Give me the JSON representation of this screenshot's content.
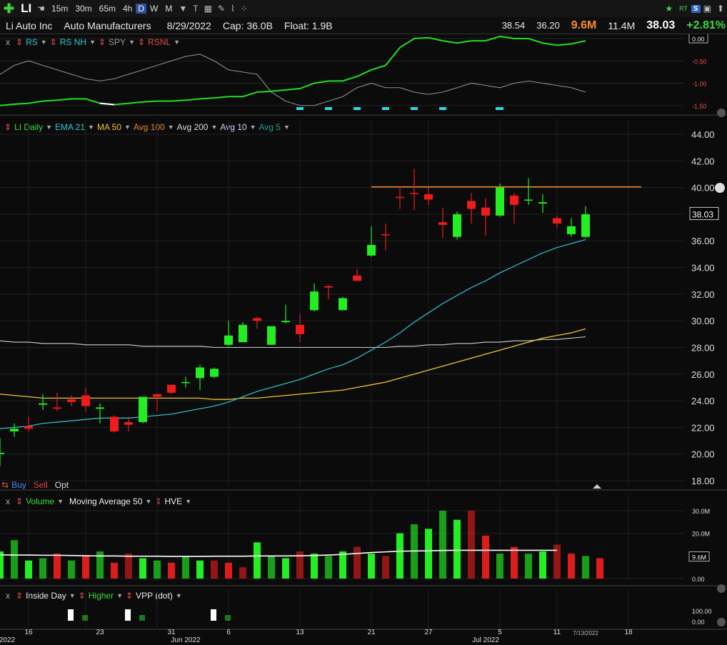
{
  "toolbar": {
    "symbol": "LI",
    "timeframes": [
      "15m",
      "30m",
      "65m",
      "4h",
      "D",
      "W",
      "M"
    ],
    "selected_timeframe": "D",
    "right_rt": "RT",
    "right_s": "S"
  },
  "info": {
    "company": "Li Auto Inc",
    "industry": "Auto Manufacturers",
    "date": "8/29/2022",
    "cap": "Cap: 36.0B",
    "float": "Float: 1.9B",
    "high": "38.54",
    "low": "36.20",
    "volume": "9.6M",
    "avg_volume": "11.4M",
    "last": "38.03",
    "change": "+2.81%"
  },
  "rs_panel": {
    "x": "x",
    "items": [
      "RS",
      "RS NH",
      "SPY",
      "RSNL"
    ],
    "axis": [
      "0.00",
      "-0.50",
      "-1.00",
      "-1.50"
    ]
  },
  "price_panel": {
    "legend": [
      "LI Daily",
      "EMA 21",
      "MA 50",
      "Avg 100",
      "Avg 200",
      "Avg 10",
      "Avg 5"
    ],
    "axis": [
      "44.00",
      "42.00",
      "40.00",
      "38.00",
      "36.00",
      "34.00",
      "32.00",
      "30.00",
      "28.00",
      "26.00",
      "24.00",
      "22.00",
      "20.00",
      "18.00"
    ],
    "last_label": "38.03",
    "buy": "Buy",
    "sell": "Sell",
    "opt": "Opt"
  },
  "volume_panel": {
    "x": "x",
    "items": [
      "Volume",
      "Moving Average 50",
      "HVE"
    ],
    "axis": [
      "30.0M",
      "20.0M",
      "9.6M",
      "0.00"
    ]
  },
  "inside_panel": {
    "x": "x",
    "items": [
      "Inside Day",
      "Higher",
      "VPP (dot)"
    ],
    "axis": [
      "100.00",
      "0.00"
    ]
  },
  "xaxis": {
    "ticks": [
      "16",
      "23",
      "31",
      "6",
      "13",
      "21",
      "27",
      "5",
      "11",
      "18"
    ],
    "months": [
      "2022",
      "Jun 2022",
      "Jul 2022"
    ],
    "current": "7/13/2022"
  },
  "chart_data": {
    "type": "candlestick",
    "title": "LI Daily",
    "ylim": [
      18,
      44
    ],
    "resistance": 40.05,
    "candles": [
      {
        "o": 20.1,
        "h": 21.2,
        "l": 19.1,
        "c": 20.0,
        "up": true
      },
      {
        "o": 21.7,
        "h": 22.3,
        "l": 21.3,
        "c": 21.9,
        "up": true
      },
      {
        "o": 22.1,
        "h": 22.8,
        "l": 21.7,
        "c": 21.9,
        "up": false
      },
      {
        "o": 23.7,
        "h": 24.5,
        "l": 23.3,
        "c": 23.8,
        "up": true
      },
      {
        "o": 23.5,
        "h": 24.6,
        "l": 23.2,
        "c": 23.4,
        "up": false
      },
      {
        "o": 24.1,
        "h": 24.4,
        "l": 23.6,
        "c": 23.9,
        "up": false
      },
      {
        "o": 24.4,
        "h": 25.0,
        "l": 23.2,
        "c": 23.6,
        "up": false
      },
      {
        "o": 23.4,
        "h": 23.8,
        "l": 22.3,
        "c": 23.5,
        "up": true
      },
      {
        "o": 22.8,
        "h": 22.9,
        "l": 21.6,
        "c": 21.7,
        "up": false
      },
      {
        "o": 22.4,
        "h": 22.8,
        "l": 21.7,
        "c": 22.2,
        "up": false
      },
      {
        "o": 22.4,
        "h": 24.3,
        "l": 22.3,
        "c": 24.3,
        "up": true
      },
      {
        "o": 24.5,
        "h": 24.5,
        "l": 23.2,
        "c": 24.3,
        "up": false
      },
      {
        "o": 25.2,
        "h": 25.2,
        "l": 24.5,
        "c": 24.6,
        "up": false
      },
      {
        "o": 25.4,
        "h": 25.8,
        "l": 25.0,
        "c": 25.4,
        "up": true
      },
      {
        "o": 25.7,
        "h": 26.7,
        "l": 24.8,
        "c": 26.5,
        "up": true
      },
      {
        "o": 25.8,
        "h": 26.5,
        "l": 25.7,
        "c": 26.4,
        "up": true
      },
      {
        "o": 28.2,
        "h": 30.0,
        "l": 28.1,
        "c": 28.9,
        "up": true
      },
      {
        "o": 28.4,
        "h": 29.9,
        "l": 28.4,
        "c": 29.7,
        "up": true
      },
      {
        "o": 30.2,
        "h": 30.3,
        "l": 29.4,
        "c": 30.0,
        "up": false
      },
      {
        "o": 28.2,
        "h": 29.6,
        "l": 28.2,
        "c": 29.6,
        "up": true
      },
      {
        "o": 30.0,
        "h": 31.2,
        "l": 29.8,
        "c": 29.9,
        "up": true
      },
      {
        "o": 29.7,
        "h": 30.5,
        "l": 28.4,
        "c": 29.0,
        "up": false
      },
      {
        "o": 30.8,
        "h": 32.8,
        "l": 30.7,
        "c": 32.2,
        "up": true
      },
      {
        "o": 32.6,
        "h": 32.7,
        "l": 31.6,
        "c": 32.5,
        "up": false
      },
      {
        "o": 30.8,
        "h": 31.8,
        "l": 30.8,
        "c": 31.7,
        "up": true
      },
      {
        "o": 33.4,
        "h": 33.9,
        "l": 33.1,
        "c": 33.0,
        "up": false
      },
      {
        "o": 34.9,
        "h": 37.1,
        "l": 34.8,
        "c": 35.7,
        "up": true
      },
      {
        "o": 36.5,
        "h": 37.3,
        "l": 35.3,
        "c": 36.5,
        "up": false
      },
      {
        "o": 39.3,
        "h": 40.1,
        "l": 38.4,
        "c": 39.3,
        "up": false
      },
      {
        "o": 39.6,
        "h": 41.4,
        "l": 38.3,
        "c": 39.6,
        "up": false
      },
      {
        "o": 39.5,
        "h": 40.0,
        "l": 38.7,
        "c": 39.1,
        "up": false
      },
      {
        "o": 37.4,
        "h": 38.5,
        "l": 36.2,
        "c": 37.2,
        "up": false
      },
      {
        "o": 36.3,
        "h": 38.2,
        "l": 36.1,
        "c": 38.0,
        "up": true
      },
      {
        "o": 39.0,
        "h": 39.6,
        "l": 37.3,
        "c": 38.4,
        "up": false
      },
      {
        "o": 38.5,
        "h": 39.2,
        "l": 36.4,
        "c": 37.9,
        "up": false
      },
      {
        "o": 37.9,
        "h": 40.3,
        "l": 37.8,
        "c": 40.0,
        "up": true
      },
      {
        "o": 39.4,
        "h": 39.6,
        "l": 37.3,
        "c": 38.7,
        "up": false
      },
      {
        "o": 39.1,
        "h": 40.7,
        "l": 38.7,
        "c": 39.1,
        "up": true
      },
      {
        "o": 38.9,
        "h": 39.5,
        "l": 38.1,
        "c": 38.8,
        "up": true
      },
      {
        "o": 37.7,
        "h": 37.9,
        "l": 37.0,
        "c": 37.3,
        "up": false
      },
      {
        "o": 36.5,
        "h": 37.7,
        "l": 36.3,
        "c": 37.1,
        "up": true
      },
      {
        "o": 36.3,
        "h": 38.6,
        "l": 36.2,
        "c": 38.0,
        "up": true
      }
    ],
    "ema21": [
      21.9,
      22.0,
      22.1,
      22.3,
      22.4,
      22.5,
      22.6,
      22.7,
      22.7,
      22.7,
      22.8,
      22.9,
      23.0,
      23.2,
      23.4,
      23.6,
      23.9,
      24.3,
      24.7,
      25.0,
      25.3,
      25.6,
      26.0,
      26.4,
      26.7,
      27.2,
      27.8,
      28.4,
      29.1,
      29.9,
      30.6,
      31.3,
      31.9,
      32.5,
      33.0,
      33.6,
      34.1,
      34.6,
      35.1,
      35.5,
      35.8,
      36.1
    ],
    "ma50": [
      24.5,
      24.4,
      24.3,
      24.2,
      24.2,
      24.2,
      24.2,
      24.2,
      24.2,
      24.2,
      24.2,
      24.2,
      24.2,
      24.2,
      24.2,
      24.1,
      24.1,
      24.2,
      24.2,
      24.3,
      24.4,
      24.5,
      24.6,
      24.7,
      24.8,
      25.0,
      25.2,
      25.4,
      25.7,
      26.0,
      26.3,
      26.6,
      26.9,
      27.2,
      27.5,
      27.8,
      28.1,
      28.4,
      28.7,
      28.9,
      29.1,
      29.4
    ],
    "avg200": [
      28.5,
      28.4,
      28.4,
      28.3,
      28.3,
      28.3,
      28.2,
      28.2,
      28.2,
      28.2,
      28.1,
      28.1,
      28.1,
      28.1,
      28.1,
      28.0,
      28.0,
      28.0,
      28.0,
      28.0,
      28.0,
      28.0,
      28.0,
      28.0,
      28.0,
      28.0,
      28.0,
      28.0,
      28.1,
      28.1,
      28.2,
      28.2,
      28.3,
      28.3,
      28.4,
      28.4,
      28.5,
      28.5,
      28.6,
      28.6,
      28.7,
      28.8
    ],
    "volume": {
      "ylim": [
        0,
        30
      ],
      "values": [
        12,
        17,
        8,
        9,
        11,
        8,
        10,
        12,
        7,
        11,
        9,
        8,
        7,
        10,
        8,
        8,
        7,
        5,
        16,
        10,
        9,
        12,
        11,
        10,
        12,
        14,
        11,
        10,
        20,
        24,
        22,
        30,
        26,
        30,
        19,
        11,
        14,
        11,
        12,
        15,
        11,
        10,
        9
      ],
      "up": [
        true,
        true,
        true,
        true,
        false,
        true,
        false,
        true,
        false,
        false,
        true,
        true,
        false,
        true,
        true,
        false,
        false,
        false,
        true,
        true,
        true,
        false,
        true,
        true,
        true,
        false,
        true,
        false,
        true,
        true,
        true,
        true,
        true,
        false,
        false,
        true,
        false,
        true,
        true,
        false,
        false,
        true
      ],
      "ma50": [
        10.5,
        10.4,
        10.4,
        10.3,
        10.3,
        10.2,
        10.1,
        10.0,
        10.0,
        9.9,
        9.9,
        9.9,
        9.8,
        9.8,
        9.8,
        9.9,
        9.9,
        9.9,
        10.0,
        10.0,
        10.0,
        10.1,
        10.2,
        10.4,
        10.7,
        11.1,
        11.5,
        11.8,
        12.1,
        12.2,
        12.3,
        12.4,
        12.5,
        12.5,
        12.5,
        12.5,
        12.5,
        12.5,
        12.5,
        12.5
      ]
    },
    "rs_line_green": [
      -1.5,
      -1.47,
      -1.45,
      -1.4,
      -1.38,
      -1.35,
      -1.35,
      -1.45,
      -1.48,
      -1.45,
      -1.42,
      -1.4,
      -1.4,
      -1.38,
      -1.35,
      -1.33,
      -1.3,
      -1.3,
      -1.2,
      -1.18,
      -1.15,
      -1.12,
      -1.0,
      -0.95,
      -0.95,
      -0.85,
      -0.7,
      -0.6,
      -0.2,
      0.0,
      0.02,
      -0.05,
      -0.1,
      -0.05,
      -0.05,
      0.05,
      0.0,
      0.0,
      -0.1,
      -0.15,
      -0.12,
      -0.05
    ],
    "spy_line": [
      -0.8,
      -0.6,
      -0.5,
      -0.6,
      -0.7,
      -0.8,
      -0.9,
      -0.95,
      -0.9,
      -0.8,
      -0.7,
      -0.6,
      -0.5,
      -0.4,
      -0.35,
      -0.5,
      -0.7,
      -0.75,
      -0.8,
      -1.2,
      -1.4,
      -1.5,
      -1.5,
      -1.4,
      -1.3,
      -1.1,
      -1.0,
      -1.1,
      -1.1,
      -1.2,
      -1.25,
      -1.2,
      -1.1,
      -1.0,
      -1.05,
      -1.1,
      -1.0,
      -0.95,
      -1.0,
      -1.05,
      -1.1,
      -1.2
    ],
    "rs_nh_dots": [
      21,
      23,
      25,
      27,
      29,
      31,
      35
    ]
  }
}
